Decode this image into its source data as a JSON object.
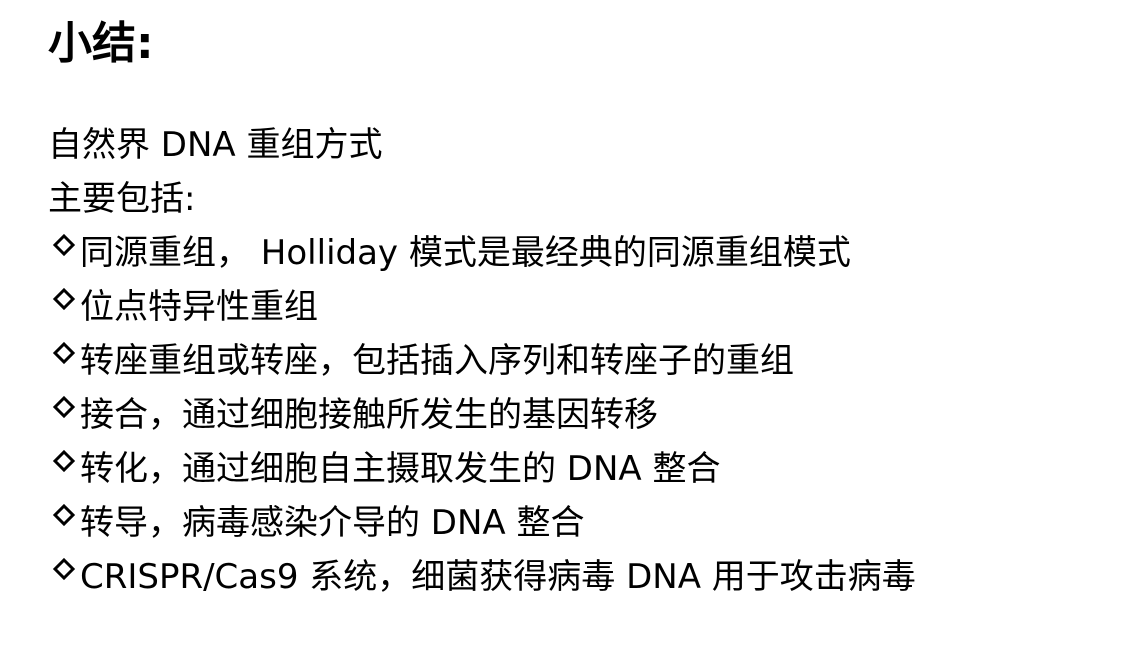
{
  "slide": {
    "title": "小结:",
    "intro": [
      "自然界 DNA 重组方式",
      "主要包括:"
    ],
    "bullet_icon": "diamond-bullet-icon",
    "items": [
      "同源重组， Holliday 模式是最经典的同源重组模式",
      "位点特异性重组",
      "转座重组或转座，包括插入序列和转座子的重组",
      "接合，通过细胞接触所发生的基因转移",
      "转化，通过细胞自主摄取发生的 DNA 整合",
      "转导，病毒感染介导的 DNA 整合",
      "CRISPR/Cas9 系统，细菌获得病毒 DNA 用于攻击病毒"
    ]
  }
}
